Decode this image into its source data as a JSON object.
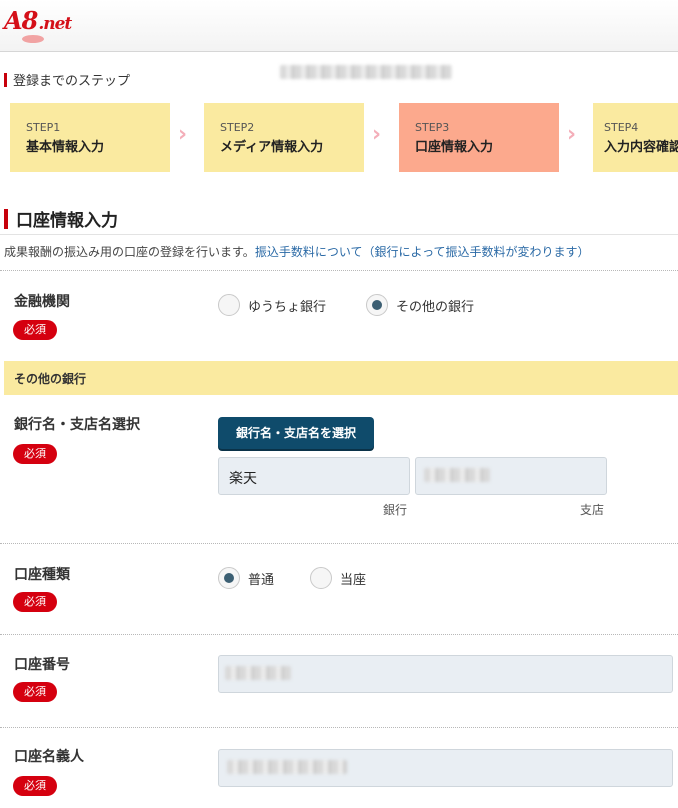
{
  "logo": {
    "text": "A8",
    "suffix": ".net"
  },
  "steps_heading": "登録までのステップ",
  "steps": [
    {
      "num": "STEP1",
      "label": "基本情報入力"
    },
    {
      "num": "STEP2",
      "label": "メディア情報入力"
    },
    {
      "num": "STEP3",
      "label": "口座情報入力",
      "active": true
    },
    {
      "num": "STEP4",
      "label": "入力内容確認"
    }
  ],
  "section_title": "口座情報入力",
  "intro": {
    "text": "成果報酬の振込み用の口座の登録を行います。",
    "link": "振込手数料について（銀行によって振込手数料が変わります）"
  },
  "fields": {
    "bank_type": {
      "label": "金融機関",
      "required": "必須",
      "options": [
        "ゆうちょ銀行",
        "その他の銀行"
      ],
      "selected": "その他の銀行"
    },
    "other_bank_band": "その他の銀行",
    "bank_select": {
      "label": "銀行名・支店名選択",
      "required": "必須",
      "button": "銀行名・支店名を選択",
      "bank_value": "楽天",
      "bank_caption": "銀行",
      "branch_caption": "支店"
    },
    "account_type": {
      "label": "口座種類",
      "required": "必須",
      "options": [
        "普通",
        "当座"
      ],
      "selected": "普通"
    },
    "account_number": {
      "label": "口座番号",
      "required": "必須"
    },
    "account_holder": {
      "label": "口座名義人",
      "required": "必須"
    }
  },
  "colors": {
    "accent": "#c7000b",
    "step": "#faeaa0",
    "step_active": "#fca98d",
    "button": "#0f4b6b"
  }
}
